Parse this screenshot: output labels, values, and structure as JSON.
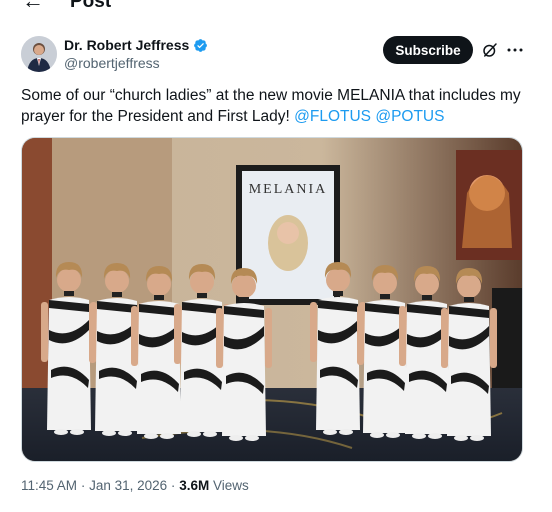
{
  "header": {
    "back_icon": "arrow-left-icon",
    "title": "Post"
  },
  "author": {
    "name": "Dr. Robert Jeffress",
    "handle": "@robertjeffress",
    "verified_icon": "verified-badge-icon",
    "verified_color": "#1d9bf0"
  },
  "actions": {
    "subscribe_label": "Subscribe",
    "grok_icon": "grok-icon",
    "more_icon": "more-dots-icon"
  },
  "tweet": {
    "text_1": "Some of our “church ladies” at the new movie MELANIA that includes my prayer for the President and First Lady!",
    "mention_1": "@FLOTUS",
    "mention_2": "@POTUS",
    "link_color": "#1d9bf0"
  },
  "media": {
    "poster_title": "MELANIA"
  },
  "meta": {
    "time": "11:45 AM",
    "separator": "·",
    "date": "Jan 31, 2026",
    "separator_2": "·",
    "views_count": "3.6M",
    "views_label": "Views"
  }
}
